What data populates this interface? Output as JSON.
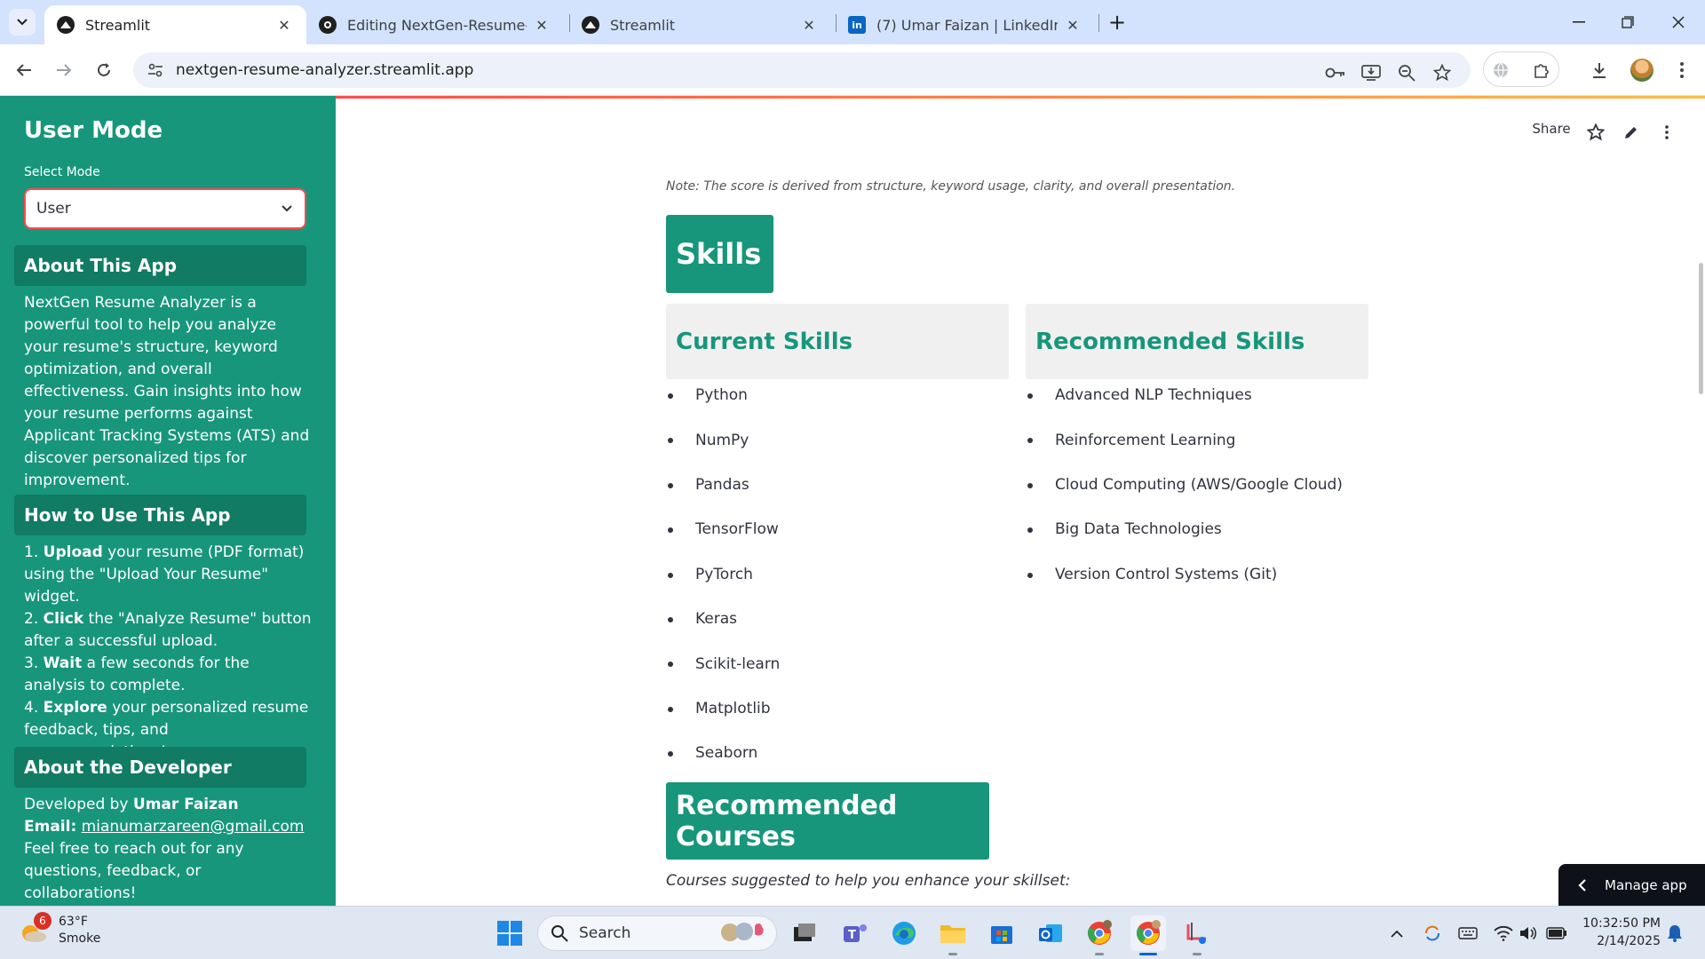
{
  "browser": {
    "tabs": [
      {
        "title": "Streamlit",
        "active": true
      },
      {
        "title": "Editing NextGen-Resume-Analy",
        "active": false
      },
      {
        "title": "Streamlit",
        "active": false
      },
      {
        "title": "(7) Umar Faizan | LinkedIn",
        "active": false
      }
    ],
    "url": "nextgen-resume-analyzer.streamlit.app"
  },
  "sidebar": {
    "title": "User Mode",
    "select_label": "Select Mode",
    "select_value": "User",
    "about": {
      "heading": "About This App",
      "text": "NextGen Resume Analyzer is a powerful tool to help you analyze your resume's structure, keyword optimization, and overall effectiveness. Gain insights into how your resume performs against Applicant Tracking Systems (ATS) and discover personalized tips for improvement."
    },
    "howto": {
      "heading": "How to Use This App",
      "steps": [
        {
          "num": "1.",
          "bold": "Upload",
          "rest": " your resume (PDF format) using the \"Upload Your Resume\" widget."
        },
        {
          "num": "2.",
          "bold": "Click",
          "rest": " the \"Analyze Resume\" button after a successful upload."
        },
        {
          "num": "3.",
          "bold": "Wait",
          "rest": " a few seconds for the analysis to complete."
        },
        {
          "num": "4.",
          "bold": "Explore",
          "rest": " your personalized resume feedback, tips, and recommendations!"
        }
      ]
    },
    "developer": {
      "heading": "About the Developer",
      "developed_by_label": "Developed by ",
      "name": "Umar Faizan",
      "email_label": "Email:",
      "email": "mianumarzareen@gmail.com",
      "outro": "Feel free to reach out for any questions, feedback, or collaborations!"
    }
  },
  "header": {
    "share_label": "Share"
  },
  "main": {
    "note": "Note: The score is derived from structure, keyword usage, clarity, and overall presentation.",
    "skills_heading": "Skills",
    "current_heading": "Current Skills",
    "recommended_heading": "Recommended Skills",
    "current_skills": [
      "Python",
      "NumPy",
      "Pandas",
      "TensorFlow",
      "PyTorch",
      "Keras",
      "Scikit-learn",
      "Matplotlib",
      "Seaborn"
    ],
    "recommended_skills": [
      "Advanced NLP Techniques",
      "Reinforcement Learning",
      "Cloud Computing (AWS/Google Cloud)",
      "Big Data Technologies",
      "Version Control Systems (Git)"
    ],
    "courses_heading": "Recommended Courses",
    "courses_note": "Courses suggested to help you enhance your skillset:",
    "manage_app_label": "Manage app"
  },
  "taskbar": {
    "weather_badge": "6",
    "temperature": "63°F",
    "condition": "Smoke",
    "search_placeholder": "Search",
    "time": "10:32:50 PM",
    "date": "2/14/2025"
  },
  "colors": {
    "sidebar_bg": "#17967b",
    "sidebar_box": "#117b64",
    "accent": "#ff4b4b",
    "heading_text": "#17967b",
    "tabstrip": "#d3e3fd"
  }
}
